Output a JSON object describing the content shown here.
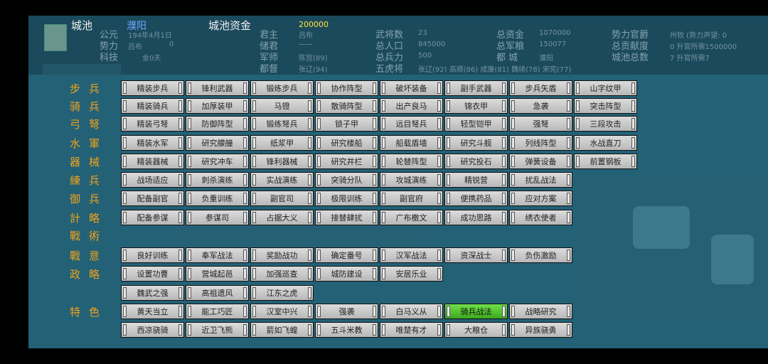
{
  "header": {
    "city_label": "城池",
    "city_name": "濮阳",
    "funds_label": "城池资金",
    "funds_value": "200000"
  },
  "info": {
    "era_label": "公元",
    "era_value": "194年4月1日",
    "force_label": "势力",
    "force_value": "吕布",
    "force_num": "0",
    "tech_label": "科技",
    "tech_value": "金0天",
    "lord_label": "君主",
    "lord_value": "吕布",
    "heir_label": "储君",
    "heir_value": "——",
    "advisor_label": "军师",
    "advisor_value": "陈宫(89)",
    "governor_label": "都督",
    "governor_value": "张辽(94)",
    "generals_label": "武将数",
    "generals_value": "23",
    "population_label": "总人口",
    "population_value": "845000",
    "troops_label": "总兵力",
    "troops_value": "500",
    "tigers_label": "五虎将",
    "tigers_value": "张辽(92)    高顺(86)    成廉(81)    魏续(78)    宋宪(77)",
    "total_funds_label": "总资金",
    "total_funds_value": "1070000",
    "total_food_label": "总军粮",
    "total_food_value": "150077",
    "capital_label": "都  城",
    "capital_value": "濮阳",
    "rank_label": "势力官爵",
    "rank_value": "州牧 (势力声望: 0",
    "merit_label": "总贡献度",
    "merit_value": "0     升官所需1500000",
    "cities_label": "城池总数",
    "cities_value": "7     升官所需7"
  },
  "rows": [
    {
      "label": "步兵",
      "buttons": [
        "精装步兵",
        "锋利武器",
        "锻练步兵",
        "协作阵型",
        "破坏装备",
        "副手武器",
        "步兵矢盾",
        "山字纹甲"
      ]
    },
    {
      "label": "骑兵",
      "buttons": [
        "精装骑兵",
        "加厚装甲",
        "马镫",
        "散骑阵型",
        "出产良马",
        "锦衣甲",
        "急袭",
        "突击阵型"
      ]
    },
    {
      "label": "弓弩",
      "buttons": [
        "精装弓弩",
        "防御阵型",
        "锻练弩兵",
        "锁子甲",
        "远目弩兵",
        "轻型铠甲",
        "强弩",
        "三段攻击"
      ]
    },
    {
      "label": "水軍",
      "buttons": [
        "精装水军",
        "研究艨艟",
        "纸浆甲",
        "研究楼船",
        "船载盾墙",
        "研究斗舰",
        "列线阵型",
        "水战直刀"
      ]
    },
    {
      "label": "器械",
      "buttons": [
        "精装器械",
        "研究冲车",
        "锋利器械",
        "研究井栏",
        "轮替阵型",
        "研究投石",
        "弹簧设备",
        "前置钢板"
      ]
    },
    {
      "label": "練兵",
      "buttons": [
        "战场适应",
        "刺杀演练",
        "实战演练",
        "突骑分队",
        "攻城演练",
        "精锐营",
        "扰乱战法"
      ]
    },
    {
      "label": "御兵",
      "buttons": [
        "配备副官",
        "负重训练",
        "副官司",
        "极限训练",
        "副官府",
        "便携药品",
        "应对方案"
      ]
    },
    {
      "label": "計略",
      "buttons": [
        "配备参谋",
        "参谋司",
        "占据大义",
        "接替肆扰",
        "广布檄文",
        "成功思路",
        "绣衣使者"
      ]
    },
    {
      "label": "戰術",
      "buttons": []
    },
    {
      "label": "戰意",
      "buttons": [
        "良好训练",
        "奉军战法",
        "奖励战功",
        "确定番号",
        "汉军战法",
        "资深战士",
        "负伤激励"
      ]
    },
    {
      "label": "政略",
      "buttons": [
        "设置功曹",
        "营城起邑",
        "加强巡查",
        "城防建设",
        "安居乐业"
      ]
    },
    {
      "label": "",
      "buttons": [
        "魏武之强",
        "高祖遗风",
        "江东之虎"
      ]
    },
    {
      "label": "特色",
      "buttons": [
        "黄天当立",
        "能工巧匠",
        "汉室中兴",
        "强袭",
        "白马义从",
        "骑兵战法",
        "战略研究"
      ]
    },
    {
      "label": "",
      "buttons": [
        "西凉骁骑",
        "近卫飞熊",
        "箭如飞蝗",
        "五斗米教",
        "唯楚有才",
        "大粮仓",
        "异族骁勇"
      ]
    }
  ],
  "selected_button": "骑兵战法",
  "colors": {
    "background": "#1b4a5c",
    "row_label": "#f0a21c",
    "city_name": "#6fa6ff",
    "funds": "#ffe23a",
    "selected": "#4cc82a"
  },
  "icons": {
    "emblem": "leaf-emblem-icon"
  }
}
